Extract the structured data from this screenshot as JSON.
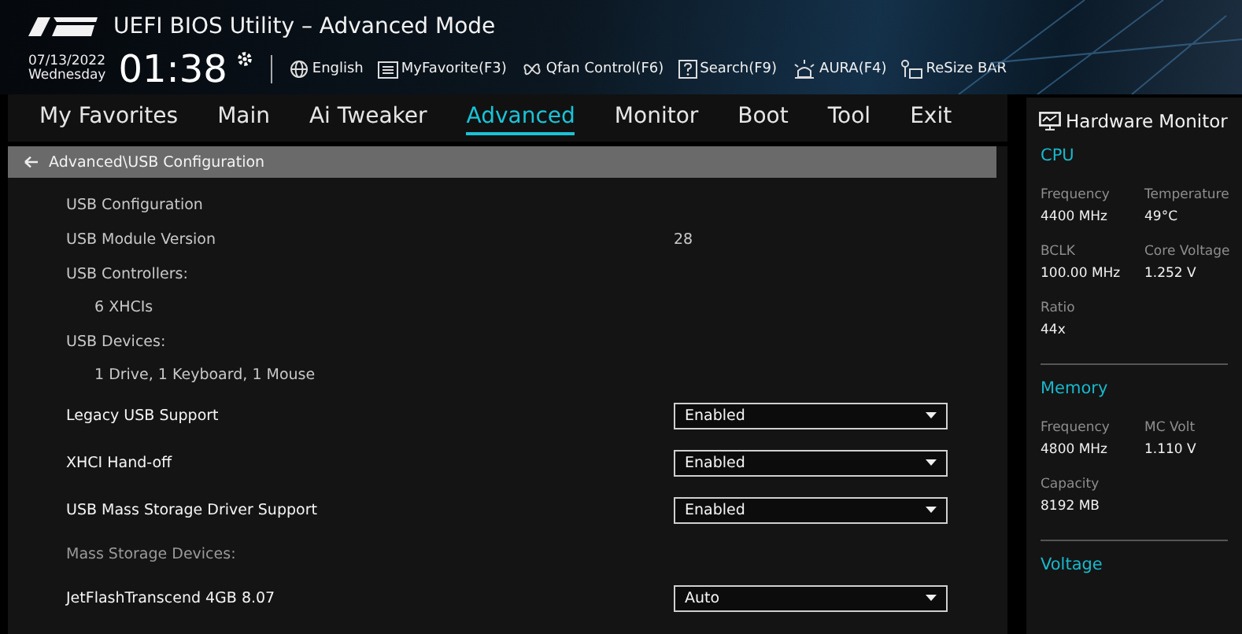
{
  "header": {
    "title": "UEFI BIOS Utility – Advanced Mode",
    "date": "07/13/2022",
    "day": "Wednesday",
    "time": "01:38",
    "tools": [
      {
        "kind": "globe",
        "label": "English"
      },
      {
        "kind": "favorite",
        "label": "MyFavorite(F3)"
      },
      {
        "kind": "fan",
        "label": "Qfan Control(F6)"
      },
      {
        "kind": "search",
        "label": "Search(F9)"
      },
      {
        "kind": "aura",
        "label": "AURA(F4)"
      },
      {
        "kind": "resize",
        "label": "ReSize BAR"
      }
    ]
  },
  "tabs": [
    {
      "label": "My Favorites",
      "selected": false
    },
    {
      "label": "Main",
      "selected": false
    },
    {
      "label": "Ai Tweaker",
      "selected": false
    },
    {
      "label": "Advanced",
      "selected": true
    },
    {
      "label": "Monitor",
      "selected": false
    },
    {
      "label": "Boot",
      "selected": false
    },
    {
      "label": "Tool",
      "selected": false
    },
    {
      "label": "Exit",
      "selected": false
    }
  ],
  "breadcrumb": "Advanced\\USB Configuration",
  "rows": [
    {
      "kind": "info",
      "label": "USB Configuration"
    },
    {
      "kind": "info",
      "label": "USB Module Version",
      "value": "28"
    },
    {
      "kind": "info",
      "label": "USB Controllers:"
    },
    {
      "kind": "detail",
      "label": "6 XHCIs"
    },
    {
      "kind": "info",
      "label": "USB Devices:"
    },
    {
      "kind": "detail",
      "label": "1 Drive, 1 Keyboard, 1 Mouse"
    },
    {
      "kind": "setting",
      "label": "Legacy USB Support",
      "value": "Enabled"
    },
    {
      "kind": "setting",
      "label": "XHCI Hand-off",
      "value": "Enabled"
    },
    {
      "kind": "setting",
      "label": "USB Mass Storage Driver Support",
      "value": "Enabled"
    },
    {
      "kind": "heading",
      "label": "Mass Storage Devices:"
    },
    {
      "kind": "setting",
      "label": "JetFlashTranscend 4GB 8.07",
      "value": "Auto"
    }
  ],
  "hardware_monitor": {
    "title": "Hardware Monitor",
    "sections": [
      {
        "name": "CPU",
        "items": [
          {
            "label": "Frequency",
            "value": "4400 MHz"
          },
          {
            "label": "Temperature",
            "value": "49°C"
          },
          {
            "label": "BCLK",
            "value": "100.00 MHz"
          },
          {
            "label": "Core Voltage",
            "value": "1.252 V"
          },
          {
            "label": "Ratio",
            "value": "44x"
          }
        ]
      },
      {
        "name": "Memory",
        "items": [
          {
            "label": "Frequency",
            "value": "4800 MHz"
          },
          {
            "label": "MC Volt",
            "value": "1.110 V"
          },
          {
            "label": "Capacity",
            "value": "8192 MB"
          }
        ]
      },
      {
        "name": "Voltage"
      }
    ]
  }
}
